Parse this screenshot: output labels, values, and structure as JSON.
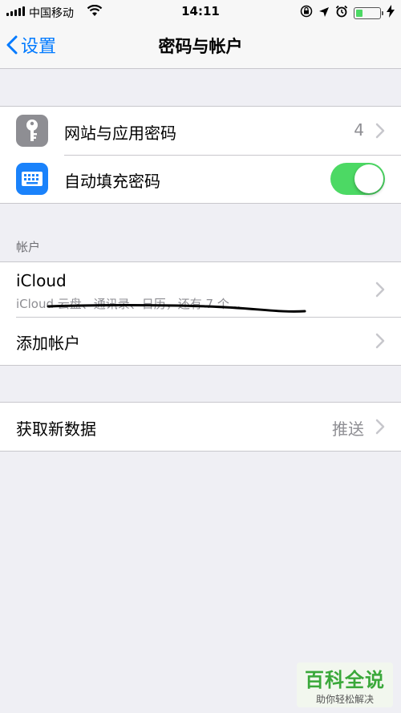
{
  "status_bar": {
    "carrier": "中国移动",
    "time": "14:11",
    "battery_level": 0.3
  },
  "nav": {
    "back_label": "设置",
    "title": "密码与帐户"
  },
  "passwords_group": {
    "items": [
      {
        "label": "网站与应用密码",
        "value": "4",
        "icon": "key-icon",
        "icon_color": "#8e8e93"
      },
      {
        "label": "自动填充密码",
        "icon": "keyboard-icon",
        "icon_color": "#1a82fb",
        "toggle_on": true
      }
    ]
  },
  "accounts": {
    "header": "帐户",
    "items": [
      {
        "label": "iCloud",
        "subtitle": "iCloud 云盘、通讯录、日历，还有 7 个..."
      },
      {
        "label": "添加帐户"
      }
    ]
  },
  "fetch": {
    "label": "获取新数据",
    "value": "推送"
  },
  "watermark": {
    "title": "百科全说",
    "subtitle": "助你轻松解决"
  },
  "colors": {
    "accent": "#007aff",
    "toggle_on": "#4cd964",
    "background": "#efeff4"
  }
}
